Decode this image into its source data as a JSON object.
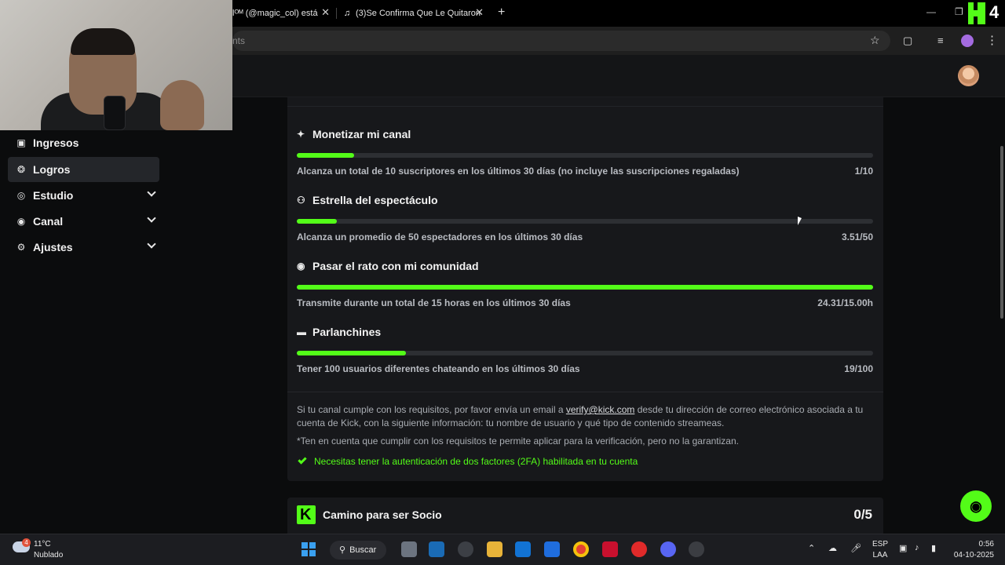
{
  "browser": {
    "tabs": [
      {
        "label": "lᴼᴹ (@magic_col) está",
        "close": "✕"
      },
      {
        "label": "(3)Se Confirma Que Le Quitaron",
        "close": "✕"
      }
    ],
    "new_tab": "+",
    "address_text": "nts",
    "corner_digit": "4"
  },
  "sidebar": {
    "items": [
      {
        "label": "Ingresos",
        "icon": "chart-icon",
        "glyph": "▣"
      },
      {
        "label": "Logros",
        "icon": "trophy-icon",
        "glyph": "❂"
      },
      {
        "label": "Estudio",
        "icon": "studio-icon",
        "glyph": "◎"
      },
      {
        "label": "Canal",
        "icon": "channel-icon",
        "glyph": "◉"
      },
      {
        "label": "Ajustes",
        "icon": "gear-icon",
        "glyph": "⚙"
      }
    ]
  },
  "goals": [
    {
      "title": "Monetizar mi canal",
      "icon": "sparkle-icon",
      "glyph": "✦",
      "description": "Alcanza un total de 10 suscriptores en los últimos 30 días (no incluye las suscripciones regaladas)",
      "value": "1/10",
      "progress": 0.1
    },
    {
      "title": "Estrella del espectáculo",
      "icon": "viewers-icon",
      "glyph": "⚇",
      "description": "Alcanza un promedio de 50 espectadores en los últimos 30 días",
      "value": "3.51/50",
      "progress": 0.07
    },
    {
      "title": "Pasar el rato con mi comunidad",
      "icon": "broadcast-icon",
      "glyph": "◉",
      "description": "Transmite durante un total de 15 horas en los últimos 30 días",
      "value": "24.31/15.00h",
      "progress": 1.0
    },
    {
      "title": "Parlanchines",
      "icon": "chat-icon",
      "glyph": "▬",
      "description": "Tener 100 usuarios diferentes chateando en los últimos 30 días",
      "value": "19/100",
      "progress": 0.19
    }
  ],
  "info": {
    "p1_before": "Si tu canal cumple con los requisitos, por favor envía un email a ",
    "email": "verify@kick.com",
    "p1_after": " desde tu dirección de correo electrónico asociada a tu cuenta de Kick, con la siguiente información: tu nombre de usuario y qué tipo de contenido streameas.",
    "note": "*Ten en cuenta que cumplir con los requisitos te permite aplicar para la verificación, pero no la garantizan.",
    "requirement": "Necesitas tener la autenticación de dos factores (2FA) habilitada en tu cuenta"
  },
  "partner": {
    "logo": "K",
    "title": "Camino para ser Socio",
    "count": "0/5"
  },
  "colors": {
    "accent": "#53fc18",
    "panel": "#17181b",
    "track": "#2d2f33"
  },
  "taskbar": {
    "weather_badge": "4",
    "temperature": "11°C",
    "condition": "Nublado",
    "search_label": "Buscar",
    "language": "ESP",
    "layout": "LAA",
    "time": "0:56",
    "date": "04-10-2025"
  }
}
